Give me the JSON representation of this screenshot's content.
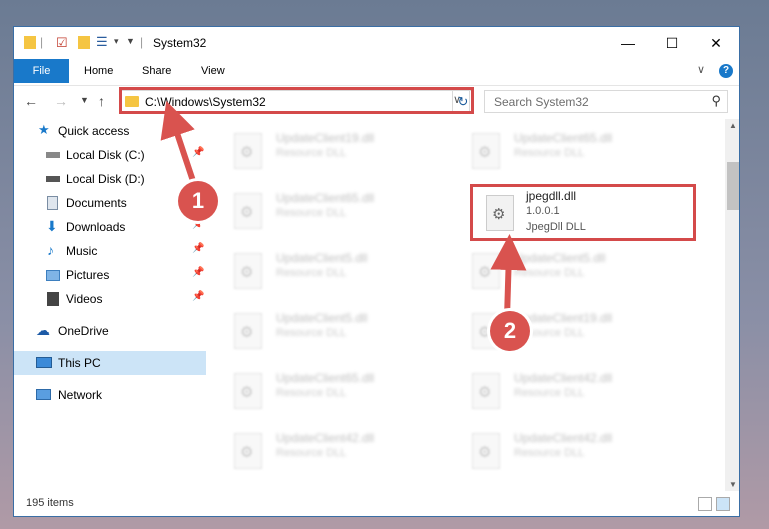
{
  "window": {
    "title": "System32"
  },
  "ribbon": {
    "file": "File",
    "tabs": [
      "Home",
      "Share",
      "View"
    ]
  },
  "address": {
    "path": "C:\\Windows\\System32",
    "search_placeholder": "Search System32"
  },
  "nav": {
    "items": [
      {
        "label": "Quick access"
      },
      {
        "label": "Local Disk (C:)"
      },
      {
        "label": "Local Disk (D:)"
      },
      {
        "label": "Documents"
      },
      {
        "label": "Downloads"
      },
      {
        "label": "Music"
      },
      {
        "label": "Pictures"
      },
      {
        "label": "Videos"
      },
      {
        "label": "OneDrive"
      },
      {
        "label": "This PC"
      },
      {
        "label": "Network"
      }
    ]
  },
  "files": {
    "left": [
      {
        "name": "UpdateClient19.dll",
        "desc": "Resource DLL"
      },
      {
        "name": "UpdateClient65.dll",
        "desc": "Resource DLL"
      },
      {
        "name": "UpdateClient5.dll",
        "desc": "Resource DLL"
      },
      {
        "name": "UpdateClient5.dll",
        "desc": "Resource DLL"
      },
      {
        "name": "UpdateClient65.dll",
        "desc": "Resource DLL"
      },
      {
        "name": "UpdateClient42.dll",
        "desc": "Resource DLL"
      }
    ],
    "right": [
      {
        "name": "UpdateClient65.dll",
        "desc": "Resource DLL"
      },
      {
        "name": "UpdateClient5.dll",
        "desc": "Resource DLL"
      },
      {
        "name": "UpdateClient19.dll",
        "desc": "Resource DLL"
      },
      {
        "name": "UpdateClient42.dll",
        "desc": "Resource DLL"
      },
      {
        "name": "UpdateClient42.dll",
        "desc": "Resource DLL"
      }
    ],
    "highlighted": {
      "name": "jpegdll.dll",
      "version": "1.0.0.1",
      "desc": "JpegDll DLL"
    }
  },
  "status": {
    "count": "195 items"
  },
  "annotations": {
    "step1": "1",
    "step2": "2",
    "color": "#d44a4a"
  }
}
